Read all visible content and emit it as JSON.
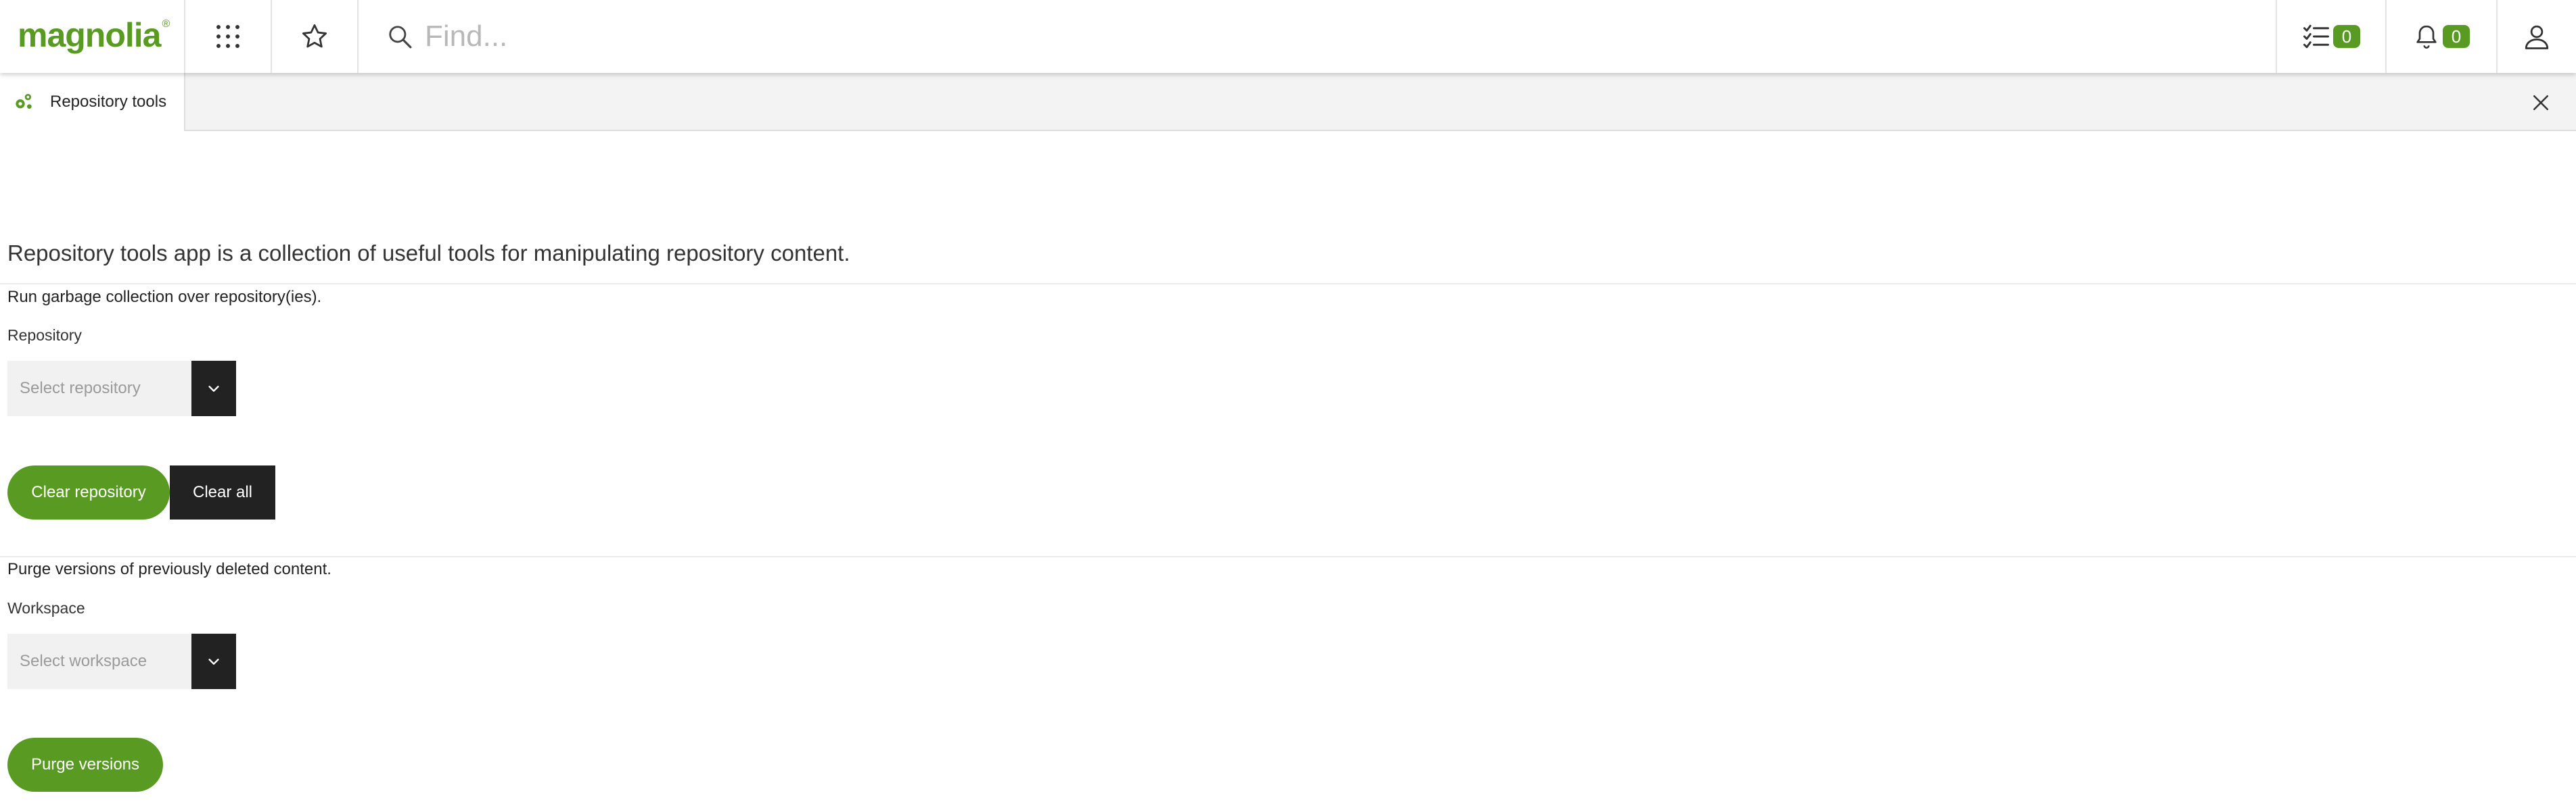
{
  "header": {
    "logo_text": "magnolia",
    "logo_mark": "®",
    "app_launcher_icon": "grid-icon",
    "favorites_icon": "star-icon",
    "search": {
      "icon": "search-icon",
      "placeholder": "Find..."
    },
    "tasks": {
      "icon": "tasks-icon",
      "count": "0"
    },
    "notifications": {
      "icon": "bell-icon",
      "count": "0"
    },
    "user_icon": "user-icon"
  },
  "tab": {
    "icon": "repository-tools-icon",
    "label": "Repository tools",
    "close_icon": "close-icon"
  },
  "main": {
    "intro": "Repository tools app is a collection of useful tools for manipulating repository content.",
    "gc_section": {
      "description": "Run garbage collection over repository(ies).",
      "field_label": "Repository",
      "select_placeholder": "Select repository",
      "clear_repository_label": "Clear repository",
      "clear_all_label": "Clear all"
    },
    "purge_section": {
      "description": "Purge versions of previously deleted content.",
      "field_label": "Workspace",
      "select_placeholder": "Select workspace",
      "purge_label": "Purge versions"
    }
  },
  "colors": {
    "accent": "#599a23",
    "dark": "#222222",
    "field_bg": "#f1f1f1",
    "tabstrip_bg": "#f3f3f3"
  }
}
